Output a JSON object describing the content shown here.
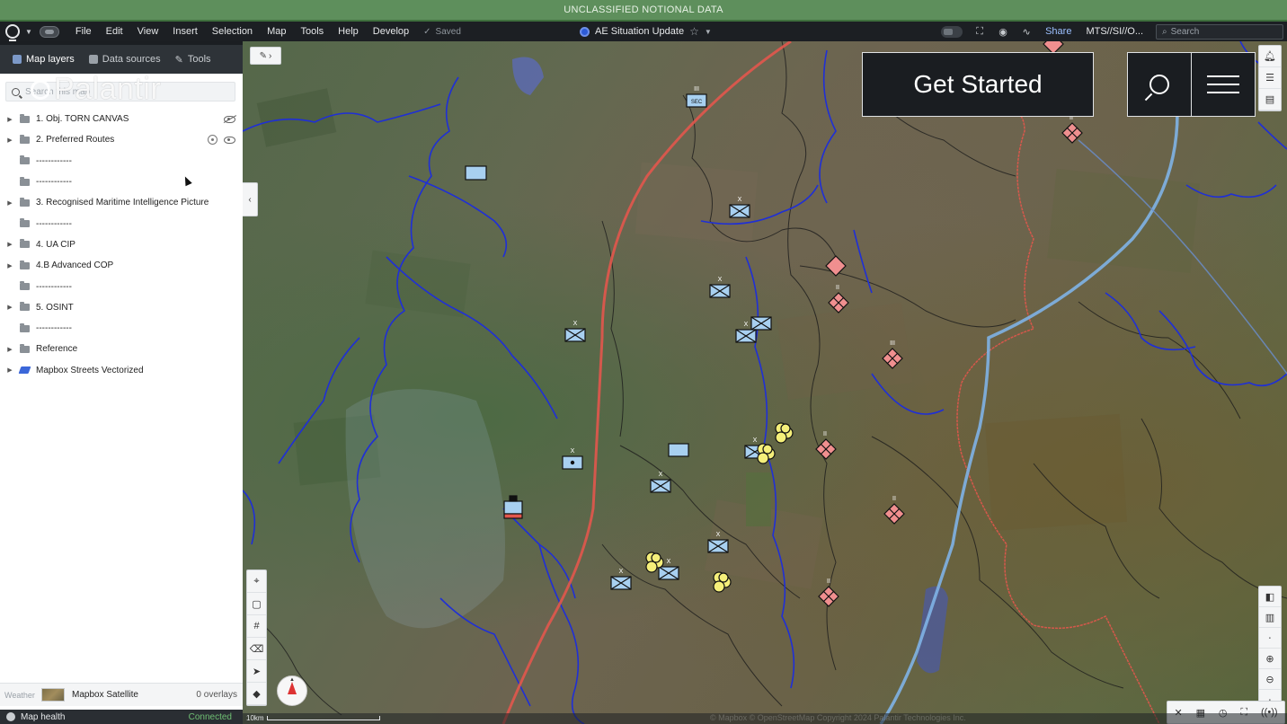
{
  "banner": {
    "text": "UNCLASSIFIED NOTIONAL DATA",
    "color": "#5e8f5c"
  },
  "menubar": {
    "items": [
      "File",
      "Edit",
      "View",
      "Insert",
      "Selection",
      "Map",
      "Tools",
      "Help",
      "Develop"
    ],
    "saved_label": "Saved",
    "document_title": "AE Situation Update",
    "share_label": "Share",
    "classification_label": "MTS//SI//O...",
    "search_placeholder": "Search"
  },
  "panel": {
    "tabs": [
      {
        "label": "Map layers",
        "icon": "layers-icon",
        "active": true
      },
      {
        "label": "Data sources",
        "icon": "database-icon",
        "active": false
      },
      {
        "label": "Tools",
        "icon": "wrench-icon",
        "active": false
      }
    ],
    "search_placeholder": "Search this map",
    "watermark": "Palantir",
    "layers": [
      {
        "label": "1. Obj. TORN CANVAS",
        "expandable": true,
        "icon": "folder-icon",
        "visibility": "hidden"
      },
      {
        "label": "2. Preferred Routes",
        "expandable": true,
        "icon": "folder-icon",
        "visibility": "visible",
        "hovered": true
      },
      {
        "label": "------------",
        "expandable": false,
        "icon": "folder-icon"
      },
      {
        "label": "------------",
        "expandable": false,
        "icon": "folder-icon"
      },
      {
        "label": "3. Recognised Maritime Intelligence Picture",
        "expandable": true,
        "icon": "folder-icon"
      },
      {
        "label": "------------",
        "expandable": false,
        "icon": "folder-icon"
      },
      {
        "label": "4. UA CIP",
        "expandable": true,
        "icon": "folder-icon"
      },
      {
        "label": "4.B Advanced COP",
        "expandable": true,
        "icon": "folder-icon"
      },
      {
        "label": "------------",
        "expandable": false,
        "icon": "folder-icon"
      },
      {
        "label": "5. OSINT",
        "expandable": true,
        "icon": "folder-icon"
      },
      {
        "label": "------------",
        "expandable": false,
        "icon": "folder-icon"
      },
      {
        "label": "Reference",
        "expandable": true,
        "icon": "folder-icon"
      },
      {
        "label": "Mapbox Streets Vectorized",
        "expandable": true,
        "icon": "mapbox-icon"
      }
    ],
    "footer": {
      "weather_label": "Weather",
      "basemap_label": "Mapbox Satellite",
      "overlays_label": "0 overlays"
    },
    "map_health": {
      "label": "Map health",
      "status": "Connected"
    }
  },
  "map": {
    "scale_label": "10km",
    "copyright": "© Mapbox © OpenStreetMap  Copyright 2024 Palantir Technologies Inc.",
    "marker_labels": {
      "sec": "SEC",
      "triple": "III",
      "double": "II",
      "single": "X"
    },
    "overlay": {
      "get_started_label": "Get Started"
    },
    "colors": {
      "friendly": "#a8d0f0",
      "hostile": "#f08f8f",
      "unknown": "#f5ef7a",
      "boundary_red": "#e2574c",
      "boundary_blue": "#7fb2e6",
      "river": "#1f2fd6"
    }
  }
}
